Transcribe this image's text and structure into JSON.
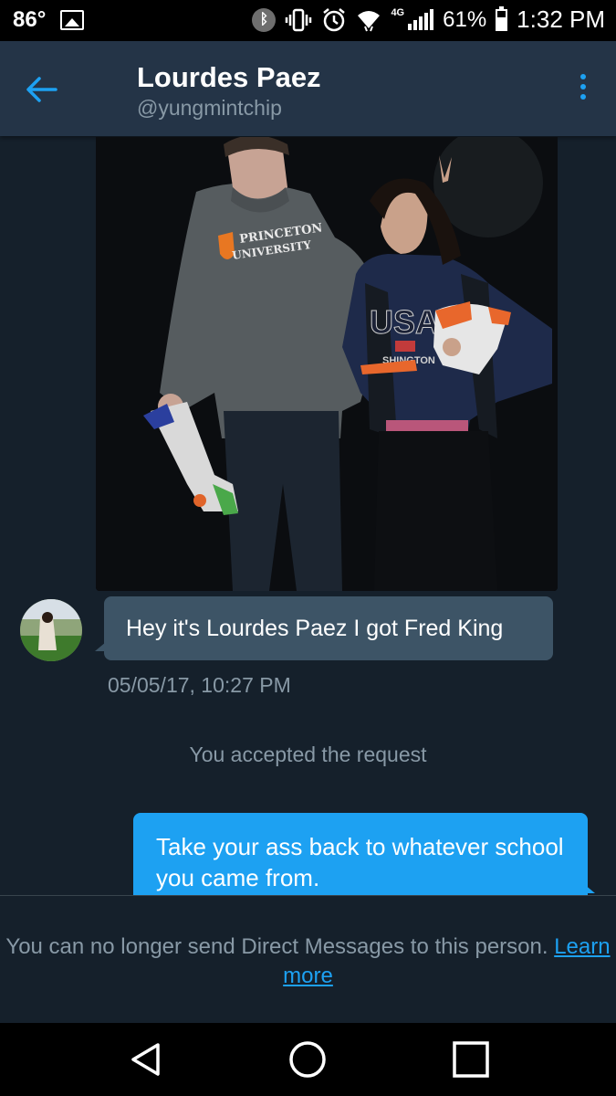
{
  "status_bar": {
    "temperature": "86°",
    "network": "4G",
    "battery_percent": "61%",
    "battery_level": 0.61,
    "time": "1:32 PM",
    "icons": [
      "image-icon",
      "bluetooth-icon",
      "vibrate-icon",
      "alarm-icon",
      "wifi-icon",
      "signal-icon",
      "battery-icon"
    ]
  },
  "header": {
    "name": "Lourdes Paez",
    "handle": "@yungmintchip",
    "back_icon": "back-arrow-icon",
    "menu_icon": "more-vert-icon"
  },
  "photo": {
    "sweatshirt_text_1": "PRINCETON",
    "sweatshirt_text_2": "UNIVERSITY",
    "shirt_text": "USA",
    "shirt_text_2": "SHINGTON"
  },
  "messages": {
    "incoming_text": "Hey it's Lourdes Paez I got Fred King",
    "incoming_timestamp": "05/05/17, 10:27 PM",
    "system_text": "You accepted the request",
    "outgoing_text": "Take your ass back to whatever school you came from."
  },
  "footer": {
    "notice": "You can no longer send Direct Messages to this person.",
    "link": "Learn more"
  },
  "colors": {
    "background": "#15202b",
    "header": "#243447",
    "accent": "#1da1f2",
    "incoming_bubble": "#3d5466",
    "secondary_text": "#8899a6"
  }
}
